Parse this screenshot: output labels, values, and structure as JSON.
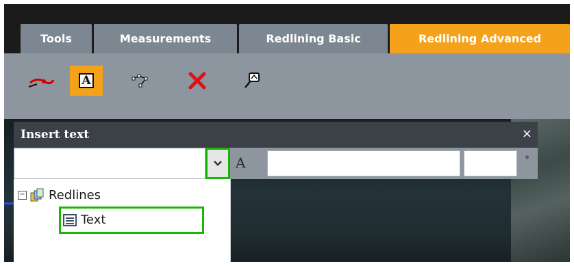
{
  "tabs": [
    {
      "label": "Tools",
      "active": false
    },
    {
      "label": "Measurements",
      "active": false
    },
    {
      "label": "Redlining Basic",
      "active": false
    },
    {
      "label": "Redlining Advanced",
      "active": true
    }
  ],
  "toolbar": {
    "tools": [
      {
        "icon": "line-icon",
        "active": false
      },
      {
        "icon": "text-tool-icon",
        "label": "A",
        "active": true
      },
      {
        "icon": "vertex-edit-icon",
        "active": false
      },
      {
        "icon": "delete-icon",
        "active": false
      },
      {
        "icon": "edit-label-icon",
        "active": false
      }
    ]
  },
  "panel": {
    "title": "Insert text",
    "close_glyph": "×",
    "combo_value": "",
    "font_glyph": "A",
    "text_value": "",
    "size_value": "",
    "degree_glyph": "°"
  },
  "tree": {
    "root_label": "Redlines",
    "root_toggle": "−",
    "child_label": "Text"
  },
  "colors": {
    "accent": "#f5a21b",
    "tab_inactive": "#7d8791",
    "toolbar_bg": "#8d959f",
    "highlight": "#16b800"
  }
}
